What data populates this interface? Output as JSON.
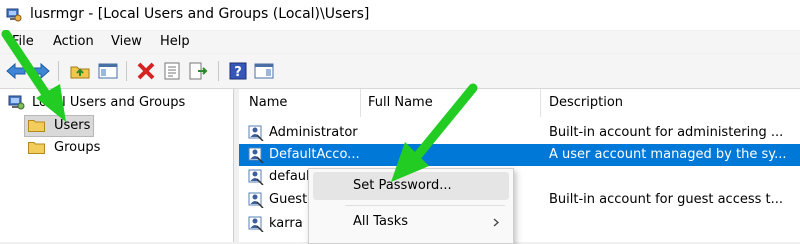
{
  "window": {
    "title": "lusrmgr - [Local Users and Groups (Local)\\Users]"
  },
  "menu": {
    "items": [
      "File",
      "Action",
      "View",
      "Help"
    ]
  },
  "toolbar": {
    "buttons": [
      "back-icon",
      "forward-icon",
      "up-folder-icon",
      "show-hide-tree-icon",
      "delete-icon",
      "properties-icon",
      "export-list-icon",
      "help-icon",
      "action-pane-icon"
    ]
  },
  "tree": {
    "root": "Local Users and Groups (Local)",
    "items": [
      {
        "label": "Users",
        "selected": true
      },
      {
        "label": "Groups",
        "selected": false
      }
    ]
  },
  "list": {
    "columns": [
      "Name",
      "Full Name",
      "Description"
    ],
    "rows": [
      {
        "name": "Administrator",
        "full_name": "",
        "description": "Built-in account for administering ...",
        "selected": false
      },
      {
        "name": "DefaultAcco...",
        "full_name": "",
        "description": "A user account managed by the sy...",
        "selected": true
      },
      {
        "name": "defaul",
        "full_name": "",
        "description": "",
        "selected": false
      },
      {
        "name": "Guest",
        "full_name": "",
        "description": "Built-in account for guest access t...",
        "selected": false
      },
      {
        "name": "karra",
        "full_name": "",
        "description": "",
        "selected": false
      }
    ]
  },
  "context_menu": {
    "items": [
      {
        "label": "Set Password...",
        "hover": true
      },
      {
        "label": "All Tasks",
        "submenu": true
      }
    ]
  },
  "colors": {
    "selection": "#0078d7",
    "arrow": "#22cc22"
  }
}
